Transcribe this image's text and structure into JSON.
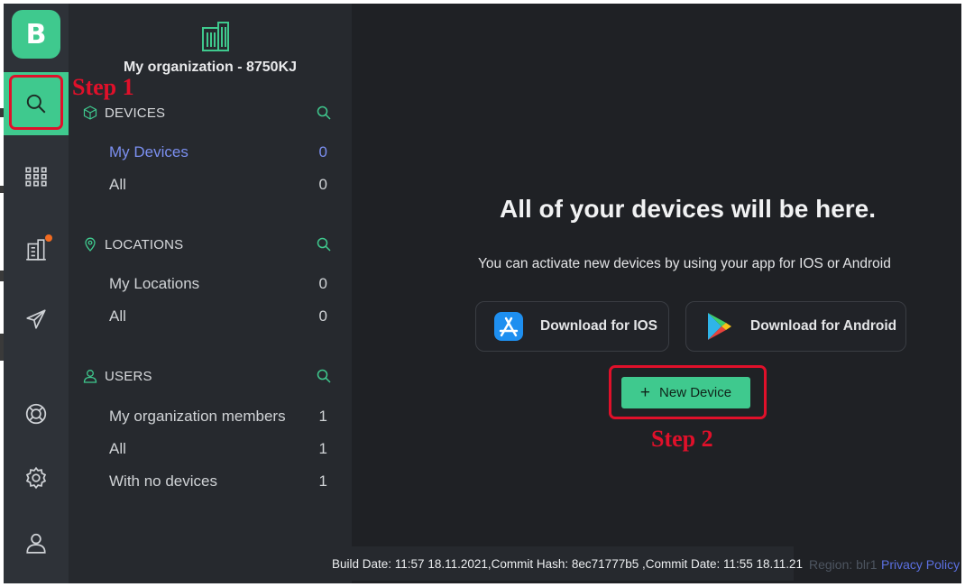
{
  "rail": {
    "logo_letter": "B",
    "items": [
      {
        "name": "search",
        "active": true
      },
      {
        "name": "apps"
      },
      {
        "name": "organization",
        "badge": true
      },
      {
        "name": "send"
      },
      {
        "name": "support"
      },
      {
        "name": "settings"
      },
      {
        "name": "profile"
      }
    ]
  },
  "sidebar": {
    "org_name": "My organization - 8750KJ",
    "sections": [
      {
        "title": "DEVICES",
        "items": [
          {
            "label": "My Devices",
            "count": "0",
            "selected": true
          },
          {
            "label": "All",
            "count": "0"
          }
        ]
      },
      {
        "title": "LOCATIONS",
        "items": [
          {
            "label": "My Locations",
            "count": "0"
          },
          {
            "label": "All",
            "count": "0"
          }
        ]
      },
      {
        "title": "USERS",
        "items": [
          {
            "label": "My organization members",
            "count": "1"
          },
          {
            "label": "All",
            "count": "1"
          },
          {
            "label": "With no devices",
            "count": "1"
          }
        ]
      }
    ]
  },
  "main": {
    "headline": "All of your devices will be here.",
    "subline": "You can activate new devices by using your app for IOS or Android",
    "ios_button": "Download for IOS",
    "android_button": "Download for Android",
    "new_device_button": "New Device",
    "new_device_plus": "+"
  },
  "annotations": {
    "step1": "Step 1",
    "step2": "Step 2"
  },
  "footer": {
    "build_info": "Build Date: 11:57 18.11.2021,Commit Hash: 8ec71777b5 ,Commit Date: 11:55 18.11.21",
    "region": "Region: blr1",
    "privacy": "Privacy Policy"
  },
  "colors": {
    "accent": "#3fc98e",
    "selected_link": "#7b8ff0",
    "annotation": "#e0102a",
    "badge": "#f26b21"
  }
}
